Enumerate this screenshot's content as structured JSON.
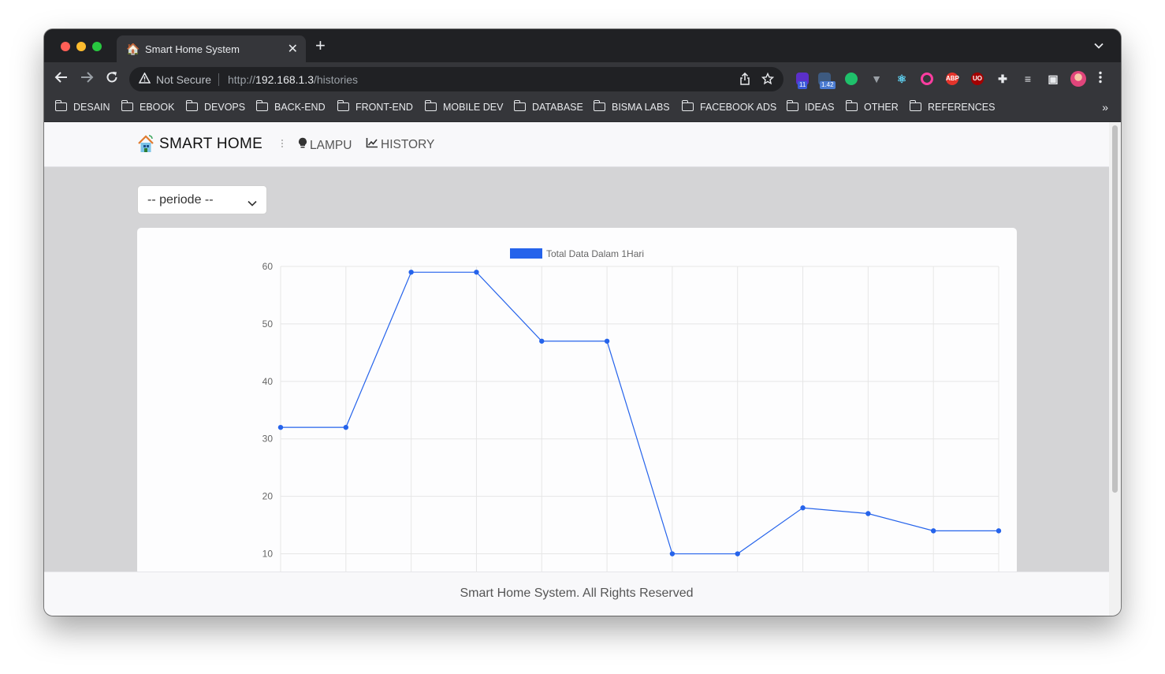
{
  "browser": {
    "tab_title": "Smart Home System",
    "tab_close": "✕",
    "new_tab": "+",
    "tab_menu": "⌄",
    "security_label": "Not Secure",
    "url_scheme": "http://",
    "url_host": "192.168.1.3",
    "url_path": "/histories",
    "extensions": [
      {
        "name": "puzzle-ext-icon",
        "badge": "11",
        "color": "#5b2fc9",
        "badge_color": "#3b5bdb"
      },
      {
        "name": "speed-ext-icon",
        "badge": "1.42",
        "color": "#3d5a80",
        "badge_color": "#4a7bd1"
      },
      {
        "name": "green-dot-ext-icon",
        "badge": "",
        "color": "#1fc16b",
        "badge_color": ""
      },
      {
        "name": "vue-ext-icon",
        "badge": "",
        "color": "#9aa0a6",
        "badge_color": ""
      },
      {
        "name": "react-ext-icon",
        "badge": "",
        "color": "#61dafb",
        "badge_color": ""
      },
      {
        "name": "color-ring-ext-icon",
        "badge": "",
        "color": "#ff3da0",
        "badge_color": ""
      },
      {
        "name": "abp-ext-icon",
        "badge": "ABP",
        "color": "#e5342b",
        "badge_color": ""
      },
      {
        "name": "ublock-ext-icon",
        "badge": "UO",
        "color": "#a30000",
        "badge_color": ""
      },
      {
        "name": "extensions-icon",
        "badge": "",
        "color": "#e8eaed",
        "badge_color": ""
      },
      {
        "name": "media-icon",
        "badge": "",
        "color": "#e8eaed",
        "badge_color": ""
      },
      {
        "name": "sidepanel-icon",
        "badge": "",
        "color": "#e8eaed",
        "badge_color": ""
      }
    ],
    "bookmarks": [
      "DESAIN",
      "EBOOK",
      "DEVOPS",
      "BACK-END",
      "FRONT-END",
      "MOBILE DEV",
      "DATABASE",
      "BISMA LABS",
      "FACEBOOK ADS",
      "IDEAS",
      "OTHER",
      "REFERENCES"
    ],
    "bookmarks_more": "»"
  },
  "navbar": {
    "brand": "SMART HOME",
    "links": [
      {
        "label": "LAMPU",
        "icon": "bulb-icon"
      },
      {
        "label": "HISTORY",
        "icon": "line-chart-icon"
      }
    ]
  },
  "filter": {
    "period_selected": "-- periode --"
  },
  "chart_data": {
    "type": "line",
    "title": "",
    "legend": "top",
    "series": [
      {
        "name": "Total Data Dalam 1Hari",
        "color": "#2563eb",
        "values": [
          32,
          32,
          59,
          59,
          47,
          47,
          10,
          10,
          18,
          17,
          14,
          14
        ]
      }
    ],
    "x_count": 12,
    "ylim": [
      0,
      60
    ],
    "yticks_visible": [
      60,
      50,
      40,
      30,
      20,
      10
    ],
    "grid": true
  },
  "footer": {
    "text": "Smart Home System. All Rights Reserved"
  }
}
